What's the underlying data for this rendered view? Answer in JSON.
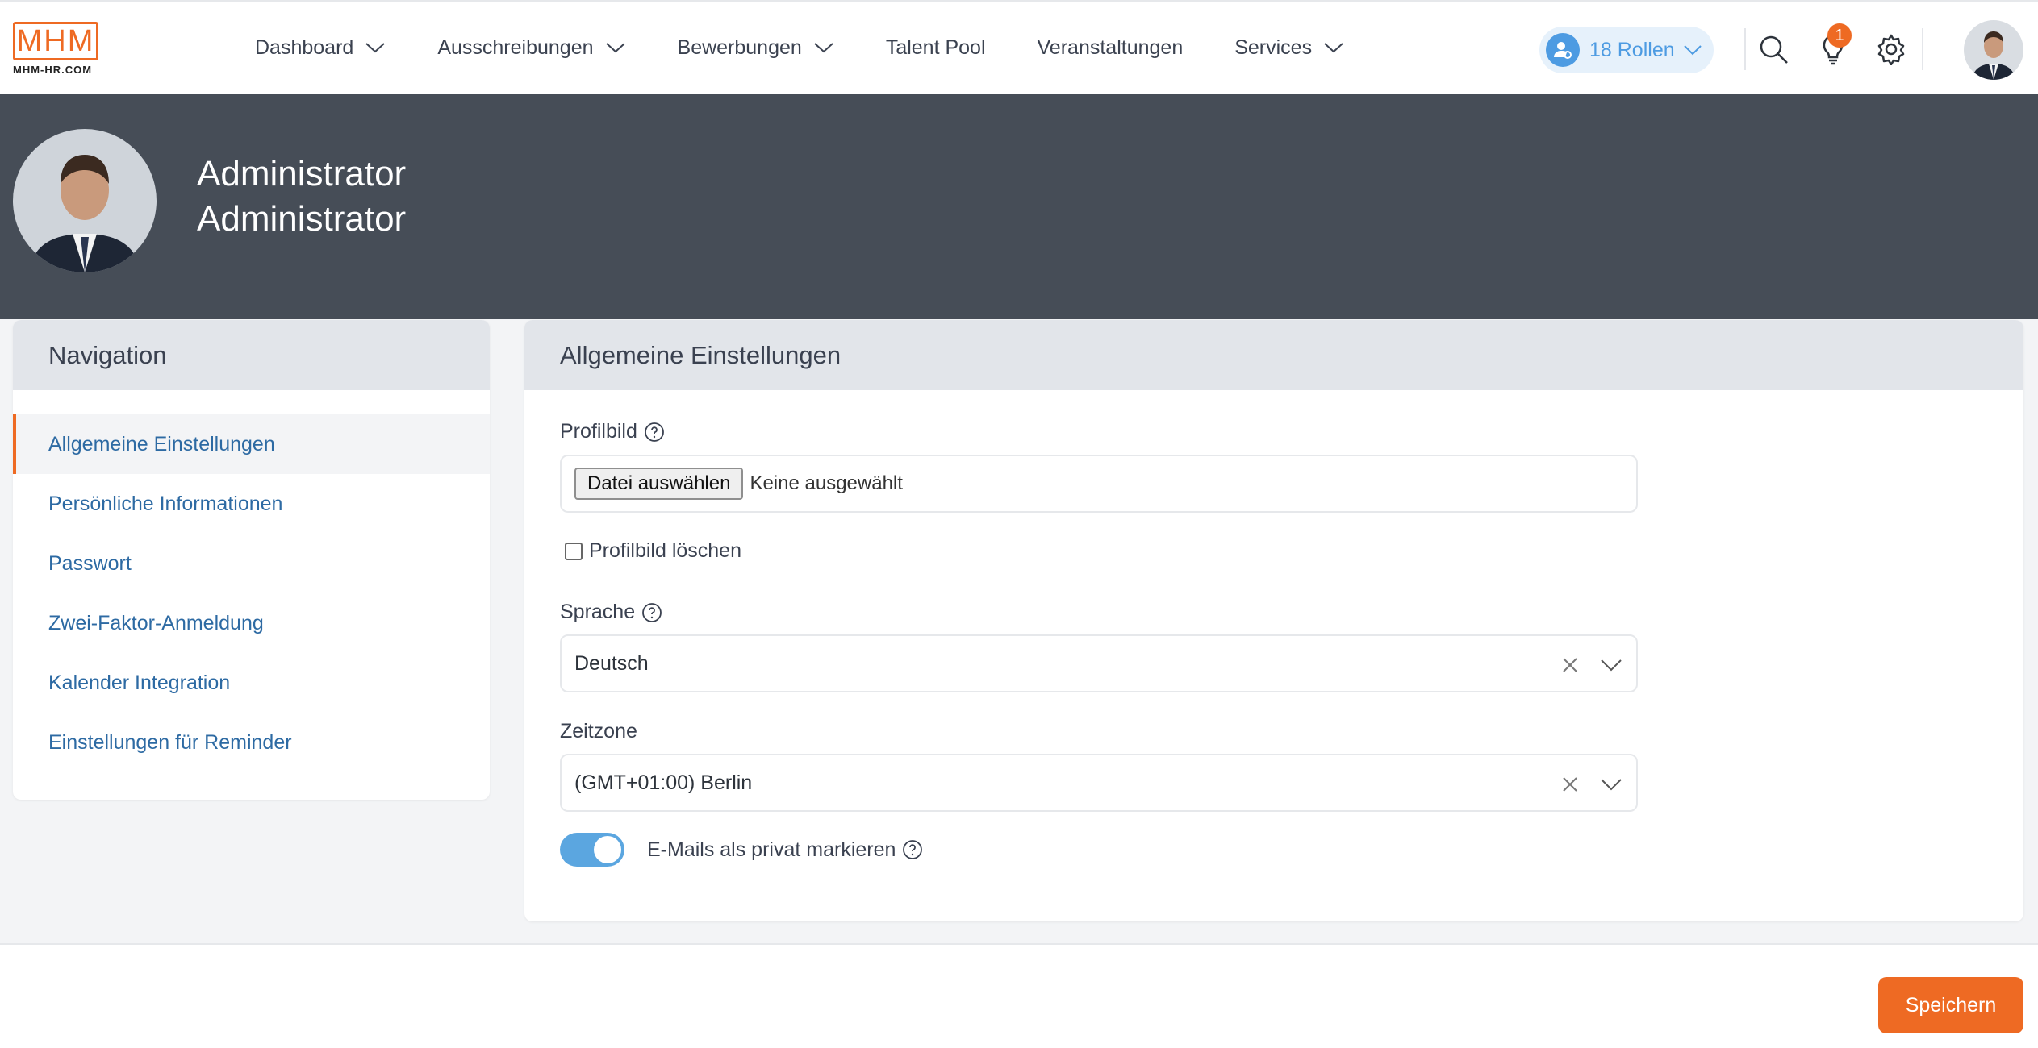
{
  "logo": {
    "mark": "MHM",
    "sub": "MHM-HR.COM"
  },
  "nav": {
    "items": [
      {
        "label": "Dashboard",
        "has_dropdown": true
      },
      {
        "label": "Ausschreibungen",
        "has_dropdown": true
      },
      {
        "label": "Bewerbungen",
        "has_dropdown": true
      },
      {
        "label": "Talent Pool",
        "has_dropdown": false
      },
      {
        "label": "Veranstaltungen",
        "has_dropdown": false
      },
      {
        "label": "Services",
        "has_dropdown": true
      }
    ]
  },
  "toolbar": {
    "roles_label": "18 Rollen",
    "notification_count": "1",
    "icons": [
      "search-icon",
      "lightbulb-icon",
      "gear-icon",
      "avatar"
    ]
  },
  "profile": {
    "first_name": "Administrator",
    "last_name": "Administrator"
  },
  "sidebar": {
    "title": "Navigation",
    "items": [
      {
        "label": "Allgemeine Einstellungen",
        "active": true
      },
      {
        "label": "Persönliche Informationen",
        "active": false
      },
      {
        "label": "Passwort",
        "active": false
      },
      {
        "label": "Zwei-Faktor-Anmeldung",
        "active": false
      },
      {
        "label": "Kalender Integration",
        "active": false
      },
      {
        "label": "Einstellungen für Reminder",
        "active": false
      }
    ]
  },
  "settings": {
    "title": "Allgemeine Einstellungen",
    "profile_image": {
      "label": "Profilbild",
      "file_button": "Datei auswählen",
      "file_status": "Keine ausgewählt"
    },
    "delete_image": {
      "label": "Profilbild löschen",
      "checked": false
    },
    "language": {
      "label": "Sprache",
      "value": "Deutsch"
    },
    "timezone": {
      "label": "Zeitzone",
      "value": "(GMT+01:00) Berlin"
    },
    "private_mail": {
      "label": "E-Mails als privat markieren",
      "enabled": true
    }
  },
  "footer": {
    "save_label": "Speichern"
  },
  "colors": {
    "accent": "#ee6a23",
    "link": "#2d6aa3",
    "toggle_on": "#5ba6e0",
    "hero_bg": "#464d57",
    "roles_bg": "#e6f1fb"
  }
}
